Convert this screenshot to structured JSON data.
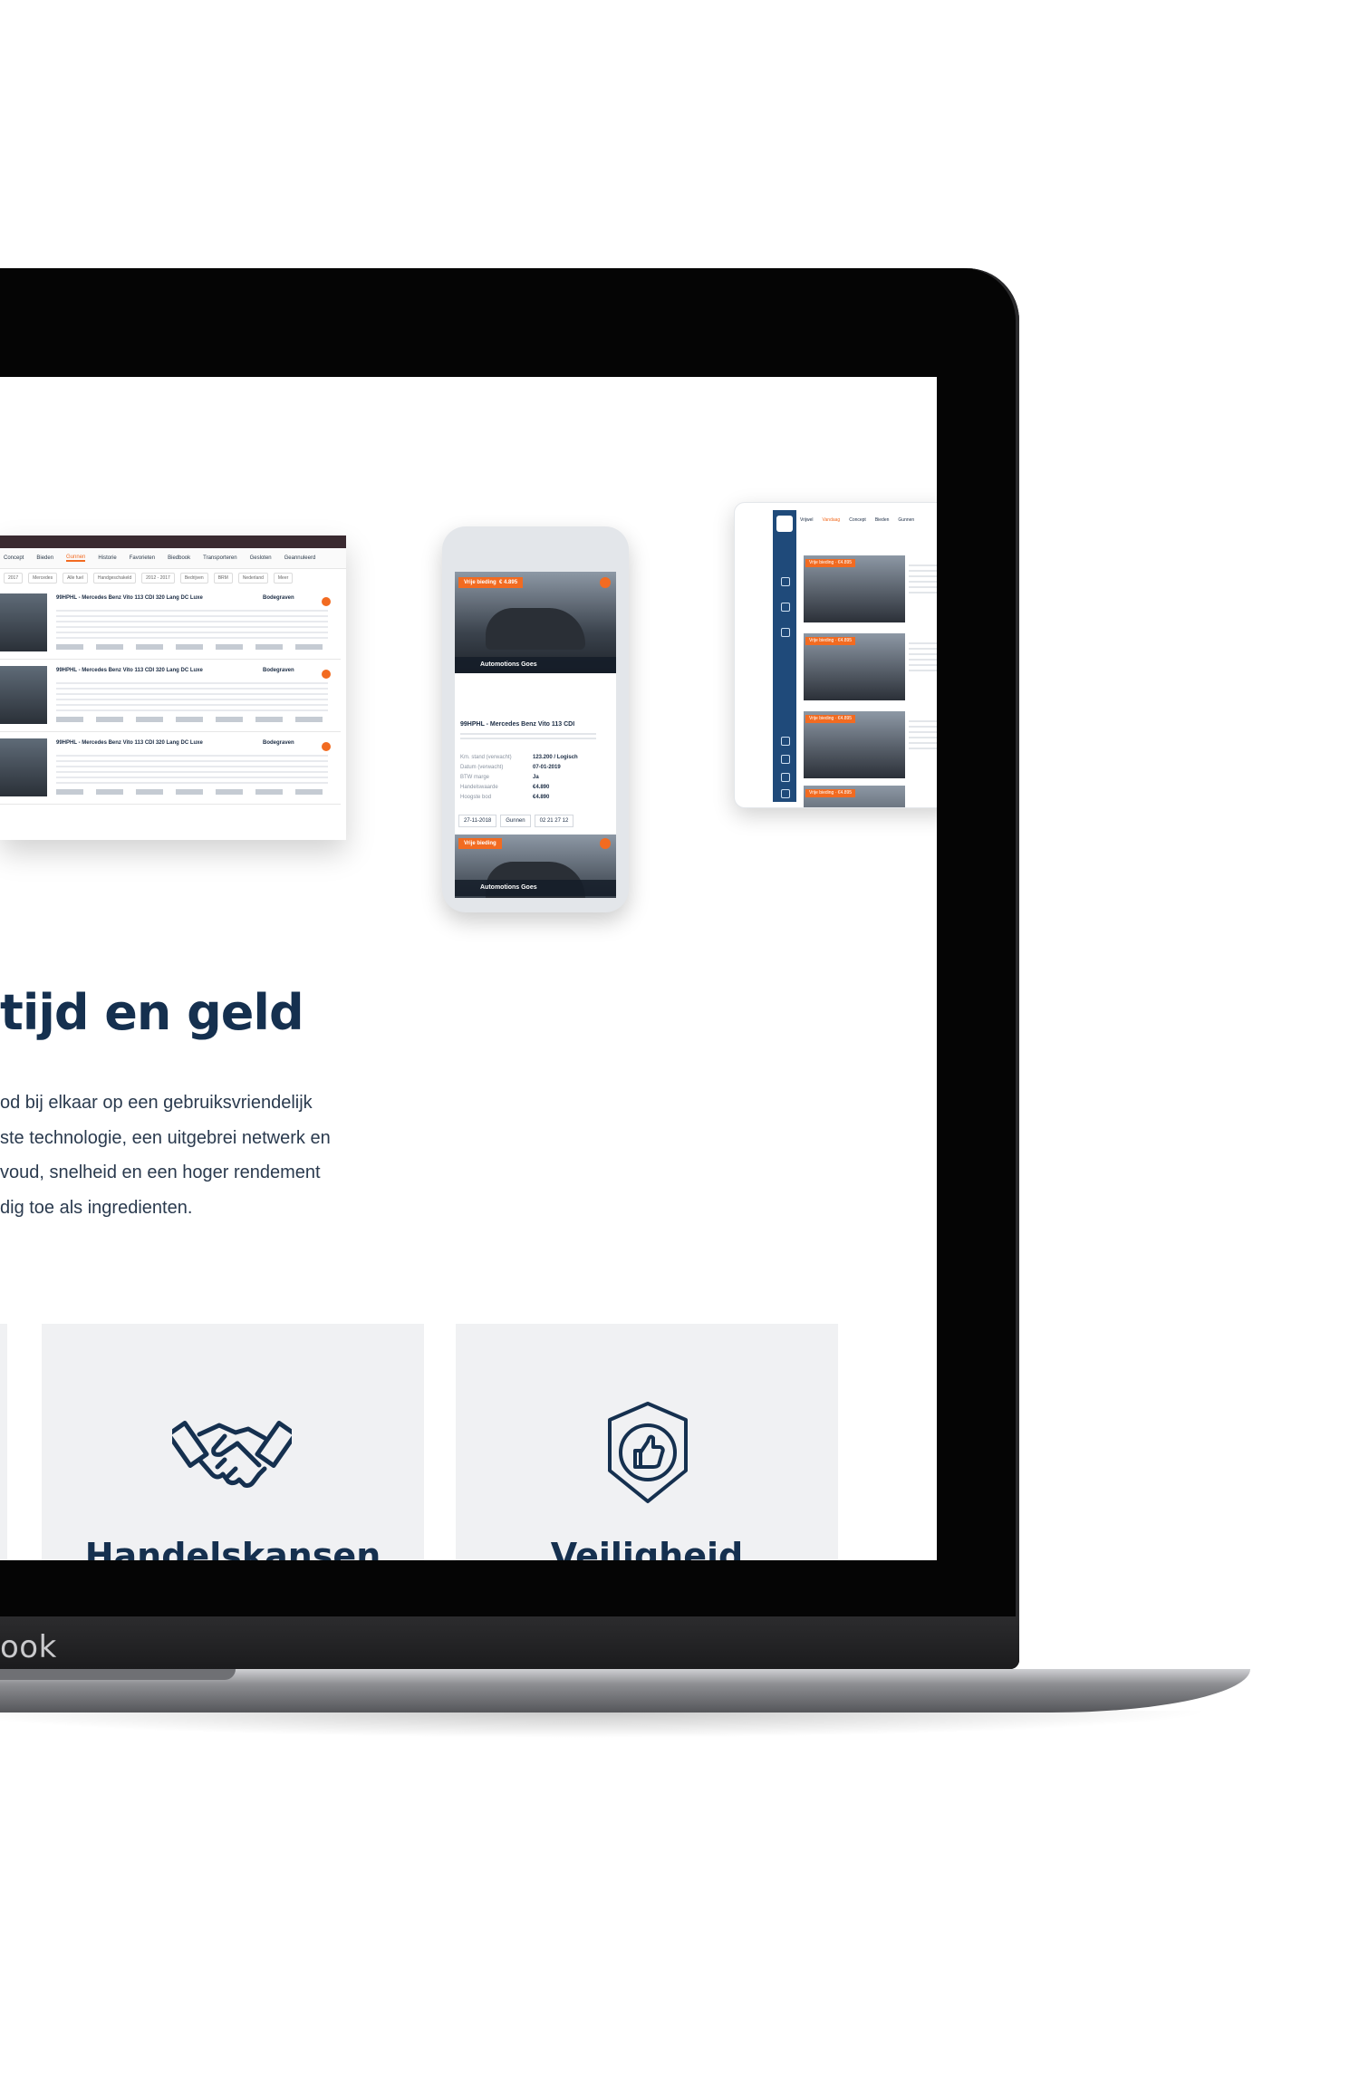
{
  "laptop": {
    "brand_text": "ook"
  },
  "desktop_mockup": {
    "tabs": [
      "Concept",
      "Bieden",
      "Gunnen",
      "Historie",
      "Favorieten",
      "Biedbook",
      "Transporteren",
      "Gesloten",
      "Geannuleerd"
    ],
    "filters": [
      "2017",
      "Mercedes",
      "Alle fuel",
      "Handgeschakeld",
      "2012 - 2017",
      "Bedrijven",
      "BRM",
      "Nederland",
      "Meer"
    ],
    "rows": [
      {
        "title": "99HPHL - Mercedes Benz Vito 113 CDI 320 Lang DC Luxe",
        "location": "Bodegraven"
      },
      {
        "title": "99HPHL - Mercedes Benz Vito 113 CDI 320 Lang DC Luxe",
        "location": "Bodegraven"
      },
      {
        "title": "99HPHL - Mercedes Benz Vito 113 CDI 320 Lang DC Luxe",
        "location": "Bodegraven"
      }
    ]
  },
  "phone_mockup": {
    "badge_top": "Vrije bieding",
    "badge_price": "€ 4.895",
    "dealer": "Automotions Goes",
    "title": "99HPHL - Mercedes Benz Vito 113 CDI",
    "specs": [
      {
        "k": "Km. stand (verwacht)",
        "v": "123.200 / Logisch"
      },
      {
        "k": "Datum (verwacht)",
        "v": "07-01-2019"
      },
      {
        "k": "BTW marge",
        "v": "Ja"
      },
      {
        "k": "Handelswaarde",
        "v": "€4.890"
      },
      {
        "k": "Hoogste bod",
        "v": "€4.890"
      }
    ],
    "actions": [
      "27-11-2018",
      "Gunnen",
      "02 21 27 12"
    ],
    "badge_bottom": "Vrije bieding",
    "dealer_bottom": "Automotions Goes"
  },
  "tablet_mockup": {
    "tabs": [
      "Vrijwel",
      "Vandaag",
      "Concept",
      "Bieden",
      "Gunnen"
    ],
    "badges": [
      "Vrije bieding · €4.895",
      "Vrije bieding · €4.895",
      "Vrije bieding · €4.895",
      "Vrije bieding · €4.895"
    ]
  },
  "section": {
    "headline": "tijd en geld",
    "body_lines": [
      "od bij elkaar op een gebruiksvriendelijk",
      "ste technologie, een uitgebrei netwerk en",
      "voud, snelheid en een hoger rendement",
      "dig toe als ingredienten."
    ]
  },
  "features": [
    {
      "icon": "handshake-icon",
      "title": "Handelskansen"
    },
    {
      "icon": "shield-thumbs-up-icon",
      "title": "Veiligheid"
    }
  ],
  "colors": {
    "accent": "#f26b21",
    "navy": "#15304f",
    "card_bg": "#f0f1f3"
  }
}
